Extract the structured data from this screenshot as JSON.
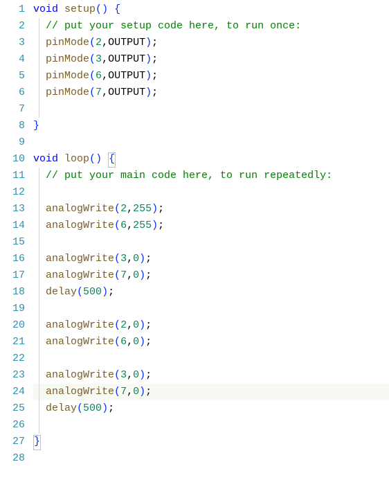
{
  "lineCount": 28,
  "currentLine": 24,
  "code": {
    "line1": {
      "kw": "void",
      "fn": "setup",
      "p1": "(",
      "p2": ")",
      "sp": " ",
      "b1": "{"
    },
    "line2": {
      "comment": "// put your setup code here, to run once:"
    },
    "line3": {
      "fn": "pinMode",
      "p1": "(",
      "a1": "2",
      "c": ",",
      "a2": "OUTPUT",
      "p2": ")",
      "s": ";"
    },
    "line4": {
      "fn": "pinMode",
      "p1": "(",
      "a1": "3",
      "c": ",",
      "a2": "OUTPUT",
      "p2": ")",
      "s": ";"
    },
    "line5": {
      "fn": "pinMode",
      "p1": "(",
      "a1": "6",
      "c": ",",
      "a2": "OUTPUT",
      "p2": ")",
      "s": ";"
    },
    "line6": {
      "fn": "pinMode",
      "p1": "(",
      "a1": "7",
      "c": ",",
      "a2": "OUTPUT",
      "p2": ")",
      "s": ";"
    },
    "line8": {
      "b2": "}"
    },
    "line10": {
      "kw": "void",
      "fn": "loop",
      "p1": "(",
      "p2": ")",
      "sp": " ",
      "b1": "{"
    },
    "line11": {
      "comment": "// put your main code here, to run repeatedly:"
    },
    "line13": {
      "fn": "analogWrite",
      "p1": "(",
      "a1": "2",
      "c": ",",
      "a2": "255",
      "p2": ")",
      "s": ";"
    },
    "line14": {
      "fn": "analogWrite",
      "p1": "(",
      "a1": "6",
      "c": ",",
      "a2": "255",
      "p2": ")",
      "s": ";"
    },
    "line16": {
      "fn": "analogWrite",
      "p1": "(",
      "a1": "3",
      "c": ",",
      "a2": "0",
      "p2": ")",
      "s": ";"
    },
    "line17": {
      "fn": "analogWrite",
      "p1": "(",
      "a1": "7",
      "c": ",",
      "a2": "0",
      "p2": ")",
      "s": ";"
    },
    "line18": {
      "fn": "delay",
      "p1": "(",
      "a1": "500",
      "p2": ")",
      "s": ";"
    },
    "line20": {
      "fn": "analogWrite",
      "p1": "(",
      "a1": "2",
      "c": ",",
      "a2": "0",
      "p2": ")",
      "s": ";"
    },
    "line21": {
      "fn": "analogWrite",
      "p1": "(",
      "a1": "6",
      "c": ",",
      "a2": "0",
      "p2": ")",
      "s": ";"
    },
    "line23": {
      "fn": "analogWrite",
      "p1": "(",
      "a1": "3",
      "c": ",",
      "a2": "0",
      "p2": ")",
      "s": ";"
    },
    "line24": {
      "fn": "analogWrite",
      "p1": "(",
      "a1": "7",
      "c": ",",
      "a2": "0",
      "p2": ")",
      "s": ";"
    },
    "line25": {
      "fn": "delay",
      "p1": "(",
      "a1": "500",
      "p2": ")",
      "s": ";"
    },
    "line27": {
      "b2": "}"
    }
  },
  "indent1": "  ",
  "lineNumbers": [
    "1",
    "2",
    "3",
    "4",
    "5",
    "6",
    "7",
    "8",
    "9",
    "10",
    "11",
    "12",
    "13",
    "14",
    "15",
    "16",
    "17",
    "18",
    "19",
    "20",
    "21",
    "22",
    "23",
    "24",
    "25",
    "26",
    "27",
    "28"
  ]
}
